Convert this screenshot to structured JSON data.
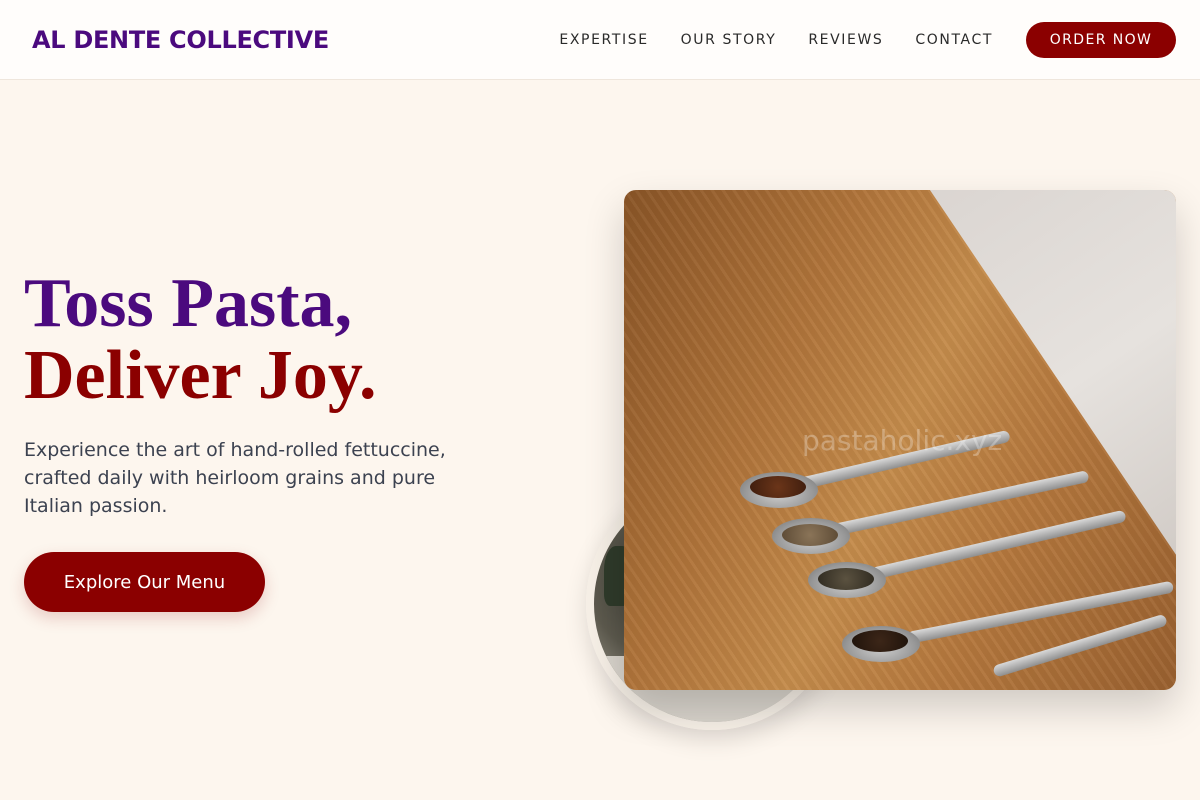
{
  "header": {
    "logo": "AL DENTE COLLECTIVE",
    "nav": [
      {
        "label": "EXPERTISE"
      },
      {
        "label": "OUR STORY"
      },
      {
        "label": "REVIEWS"
      },
      {
        "label": "CONTACT"
      }
    ],
    "order_label": "ORDER NOW"
  },
  "hero": {
    "title_line1": "Toss Pasta,",
    "title_line2": "Deliver Joy.",
    "subtitle": "Experience the art of hand-rolled fettuccine, crafted daily with heirloom grains and pure Italian passion.",
    "cta_label": "Explore Our Menu",
    "image_watermark": "pastaholic.xyz"
  },
  "colors": {
    "brand_purple": "#4b0a7e",
    "brand_red": "#8b0000",
    "background": "#fdf6ee"
  }
}
